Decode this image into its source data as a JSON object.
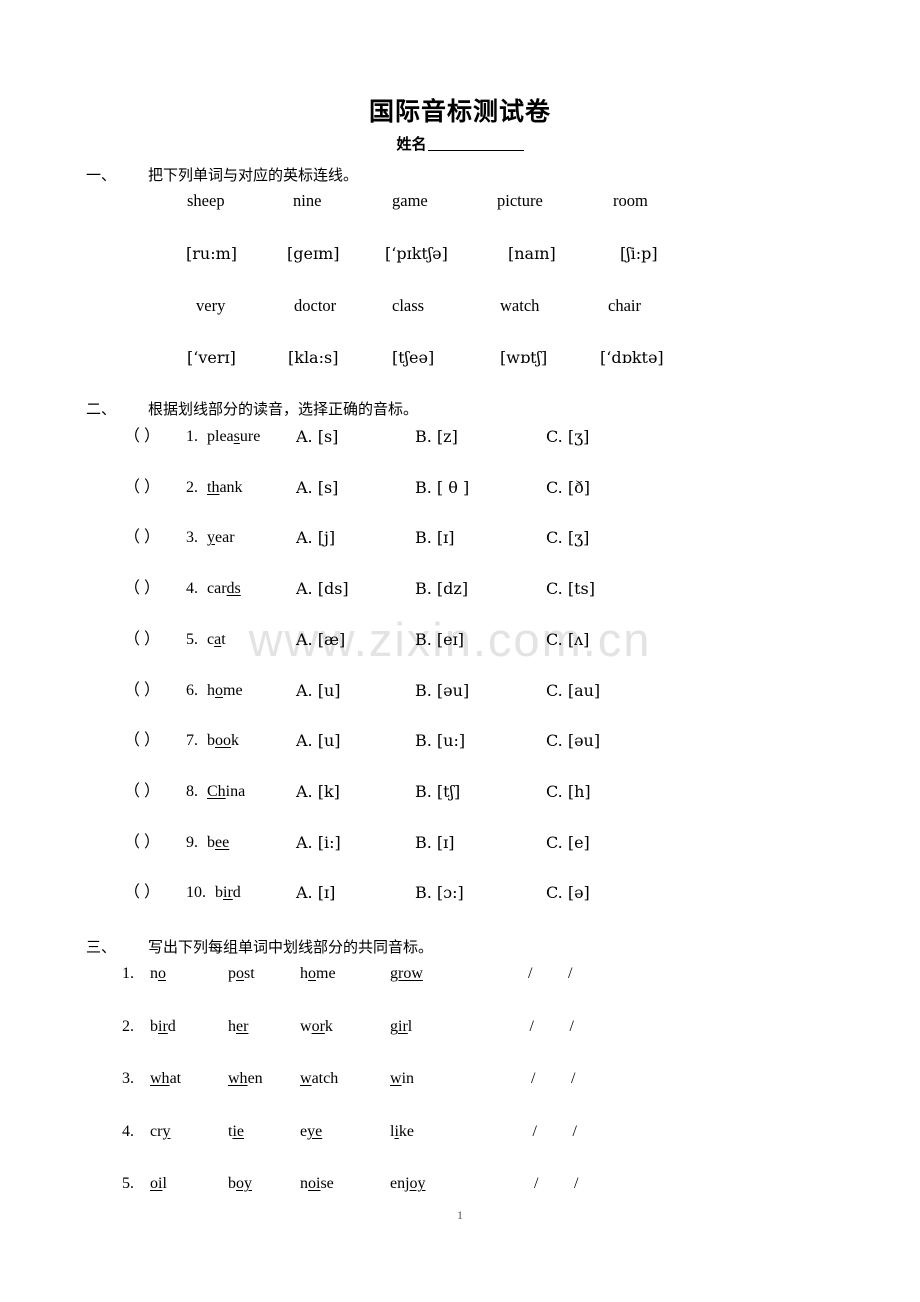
{
  "document": {
    "title": "国际音标测试卷",
    "name_label": "姓名",
    "page_number": "1",
    "watermark": "www.zixin.com.cn"
  },
  "section1": {
    "number": "一、",
    "heading": "把下列单词与对应的英标连线。",
    "row1_words": [
      "sheep",
      "nine",
      "game",
      "picture",
      "room"
    ],
    "row1_ipa": [
      "[ru:m]",
      "[geɪm]",
      "[‘pɪktʃə]",
      "[naɪn]",
      "[ʃi:p]"
    ],
    "row2_words": [
      "very",
      "doctor",
      "class",
      "watch",
      "chair"
    ],
    "row2_ipa": [
      "[‘verɪ]",
      "[kla:s]",
      "[tʃeə]",
      "[wɒtʃ]",
      "[‘dɒktə]"
    ]
  },
  "section2": {
    "number": "二、",
    "heading": "根据划线部分的读音，选择正确的音标。",
    "bracket": "（   ）",
    "items": [
      {
        "num": "1.",
        "pre": "plea",
        "mid": "s",
        "post": "ure",
        "a": "A. [s]",
        "b": "B. [z]",
        "c": "C. [ʒ]"
      },
      {
        "num": "2.",
        "pre": "",
        "mid": "th",
        "post": "ank",
        "a": "A. [s]",
        "b": "B. [ θ ]",
        "c": "C. [ð]"
      },
      {
        "num": "3.",
        "pre": "",
        "mid": "y",
        "post": "ear",
        "a": "A. [j]",
        "b": "B. [ɪ]",
        "c": "C. [ʒ]"
      },
      {
        "num": "4.",
        "pre": "car",
        "mid": "ds",
        "post": "",
        "a": "A. [ds]",
        "b": "B. [dz]",
        "c": "C. [ts]"
      },
      {
        "num": "5.",
        "pre": "c",
        "mid": "a",
        "post": "t",
        "a": "A. [æ]",
        "b": "B. [eɪ]",
        "c": "C. [ʌ]"
      },
      {
        "num": "6.",
        "pre": "h",
        "mid": "o",
        "post": "me",
        "a": "A. [u]",
        "b": "B. [əu]",
        "c": "C. [au]"
      },
      {
        "num": "7.",
        "pre": "b",
        "mid": "oo",
        "post": "k",
        "a": "A. [u]",
        "b": "B. [u:]",
        "c": "C. [əu]"
      },
      {
        "num": "8.",
        "pre": "",
        "mid": "Ch",
        "post": "ina",
        "a": "A. [k]",
        "b": "B. [tʃ]",
        "c": "C. [h]"
      },
      {
        "num": "9.",
        "pre": "b",
        "mid": "ee",
        "post": "",
        "a": "A. [i:]",
        "b": "B. [ɪ]",
        "c": "C. [e]"
      },
      {
        "num": "10.",
        "pre": "b",
        "mid": "ir",
        "post": "d",
        "a": "A. [ɪ]",
        "b": "B. [ɔ:]",
        "c": "C. [ə]"
      }
    ]
  },
  "section3": {
    "number": "三、",
    "heading": "写出下列每组单词中划线部分的共同音标。",
    "slash": "/",
    "rows": [
      {
        "num": "1.",
        "words": [
          {
            "pre": "n",
            "mid": "o",
            "post": ""
          },
          {
            "pre": "p",
            "mid": "o",
            "post": "st"
          },
          {
            "pre": "h",
            "mid": "o",
            "post": "me"
          },
          {
            "pre": "",
            "mid": "grow",
            "post": ""
          }
        ]
      },
      {
        "num": "2.",
        "words": [
          {
            "pre": "b",
            "mid": "ir",
            "post": "d"
          },
          {
            "pre": "h",
            "mid": "er ",
            "post": ""
          },
          {
            "pre": "w",
            "mid": "or",
            "post": "k"
          },
          {
            "pre": "g",
            "mid": "ir",
            "post": "l"
          }
        ]
      },
      {
        "num": "3.",
        "words": [
          {
            "pre": "",
            "mid": "wh",
            "post": "at"
          },
          {
            "pre": "",
            "mid": "wh",
            "post": "en"
          },
          {
            "pre": "",
            "mid": "w",
            "post": "atch"
          },
          {
            "pre": "",
            "mid": "w",
            "post": "in"
          }
        ]
      },
      {
        "num": "4.",
        "words": [
          {
            "pre": "cr",
            "mid": "y",
            "post": ""
          },
          {
            "pre": "t",
            "mid": "ie",
            "post": ""
          },
          {
            "pre": "e",
            "mid": "ye",
            "post": ""
          },
          {
            "pre": "l",
            "mid": "i",
            "post": "ke"
          }
        ]
      },
      {
        "num": "5.",
        "words": [
          {
            "pre": "",
            "mid": "oi",
            "post": "l"
          },
          {
            "pre": "b",
            "mid": "oy",
            "post": ""
          },
          {
            "pre": "n",
            "mid": "oi",
            "post": "se"
          },
          {
            "pre": "enj",
            "mid": "oy",
            "post": ""
          }
        ]
      }
    ]
  }
}
